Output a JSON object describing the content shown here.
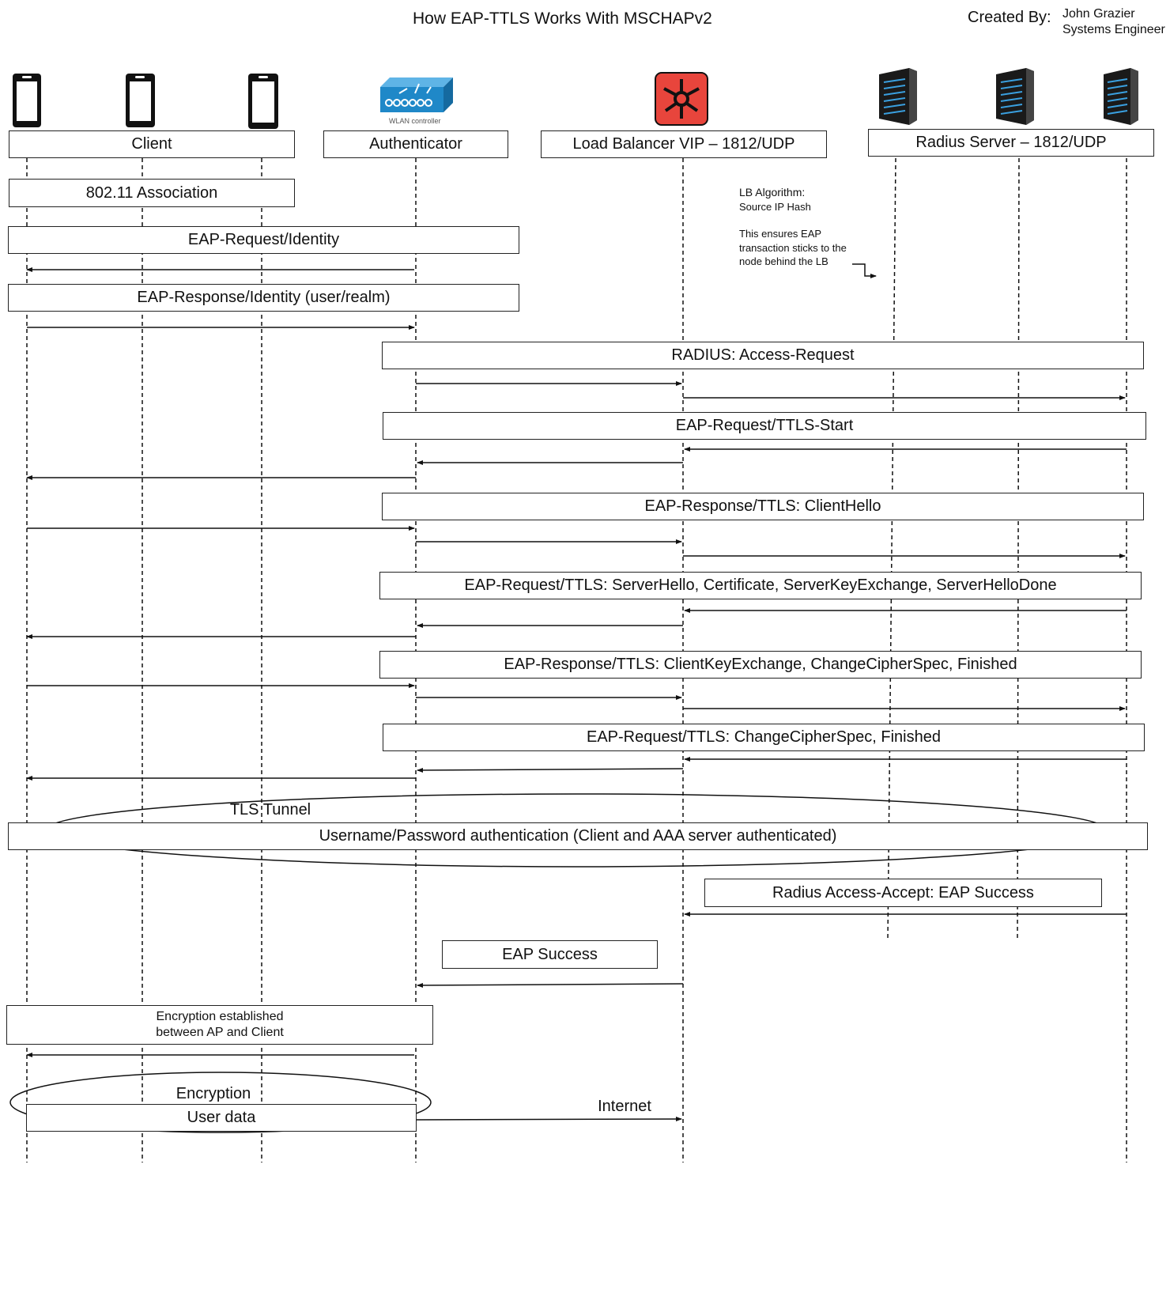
{
  "header": {
    "title": "How EAP-TTLS Works With MSCHAPv2",
    "created_by_label": "Created By:",
    "author_name": "John Grazier",
    "author_role": "Systems Engineer"
  },
  "actors": {
    "client": "Client",
    "authenticator": "Authenticator",
    "authenticator_device_caption": "WLAN controller",
    "load_balancer": "Load Balancer VIP – 1812/UDP",
    "radius": "Radius Server – 1812/UDP"
  },
  "note": {
    "line1": "LB Algorithm:",
    "line2": "Source IP Hash",
    "line3": "This ensures EAP",
    "line4": "transaction sticks to the",
    "line5": "node behind the LB"
  },
  "messages": {
    "assoc": "802.11 Association",
    "req_identity": "EAP-Request/Identity",
    "resp_identity": "EAP-Response/Identity (user/realm)",
    "radius_access_request": "RADIUS: Access-Request",
    "ttls_start": "EAP-Request/TTLS-Start",
    "client_hello": "EAP-Response/TTLS: ClientHello",
    "server_hello": "EAP-Request/TTLS: ServerHello, Certificate, ServerKeyExchange, ServerHelloDone",
    "client_key_exchange": "EAP-Response/TTLS: ClientKeyExchange, ChangeCipherSpec, Finished",
    "change_cipher": "EAP-Request/TTLS: ChangeCipherSpec, Finished",
    "tls_tunnel": "TLS Tunnel",
    "user_auth": "Username/Password authentication (Client and AAA server authenticated)",
    "access_accept": "Radius Access-Accept: EAP Success",
    "eap_success": "EAP Success",
    "encryption_established_1": "Encryption established",
    "encryption_established_2": "between AP and Client",
    "encryption": "Encryption",
    "user_data": "User data",
    "internet": "Internet"
  },
  "colors": {
    "lb_icon": "#e8453c",
    "wlan_icon": "#1f88c8",
    "server_icon": "#1a1a1a",
    "server_led": "#3aa0e0"
  }
}
